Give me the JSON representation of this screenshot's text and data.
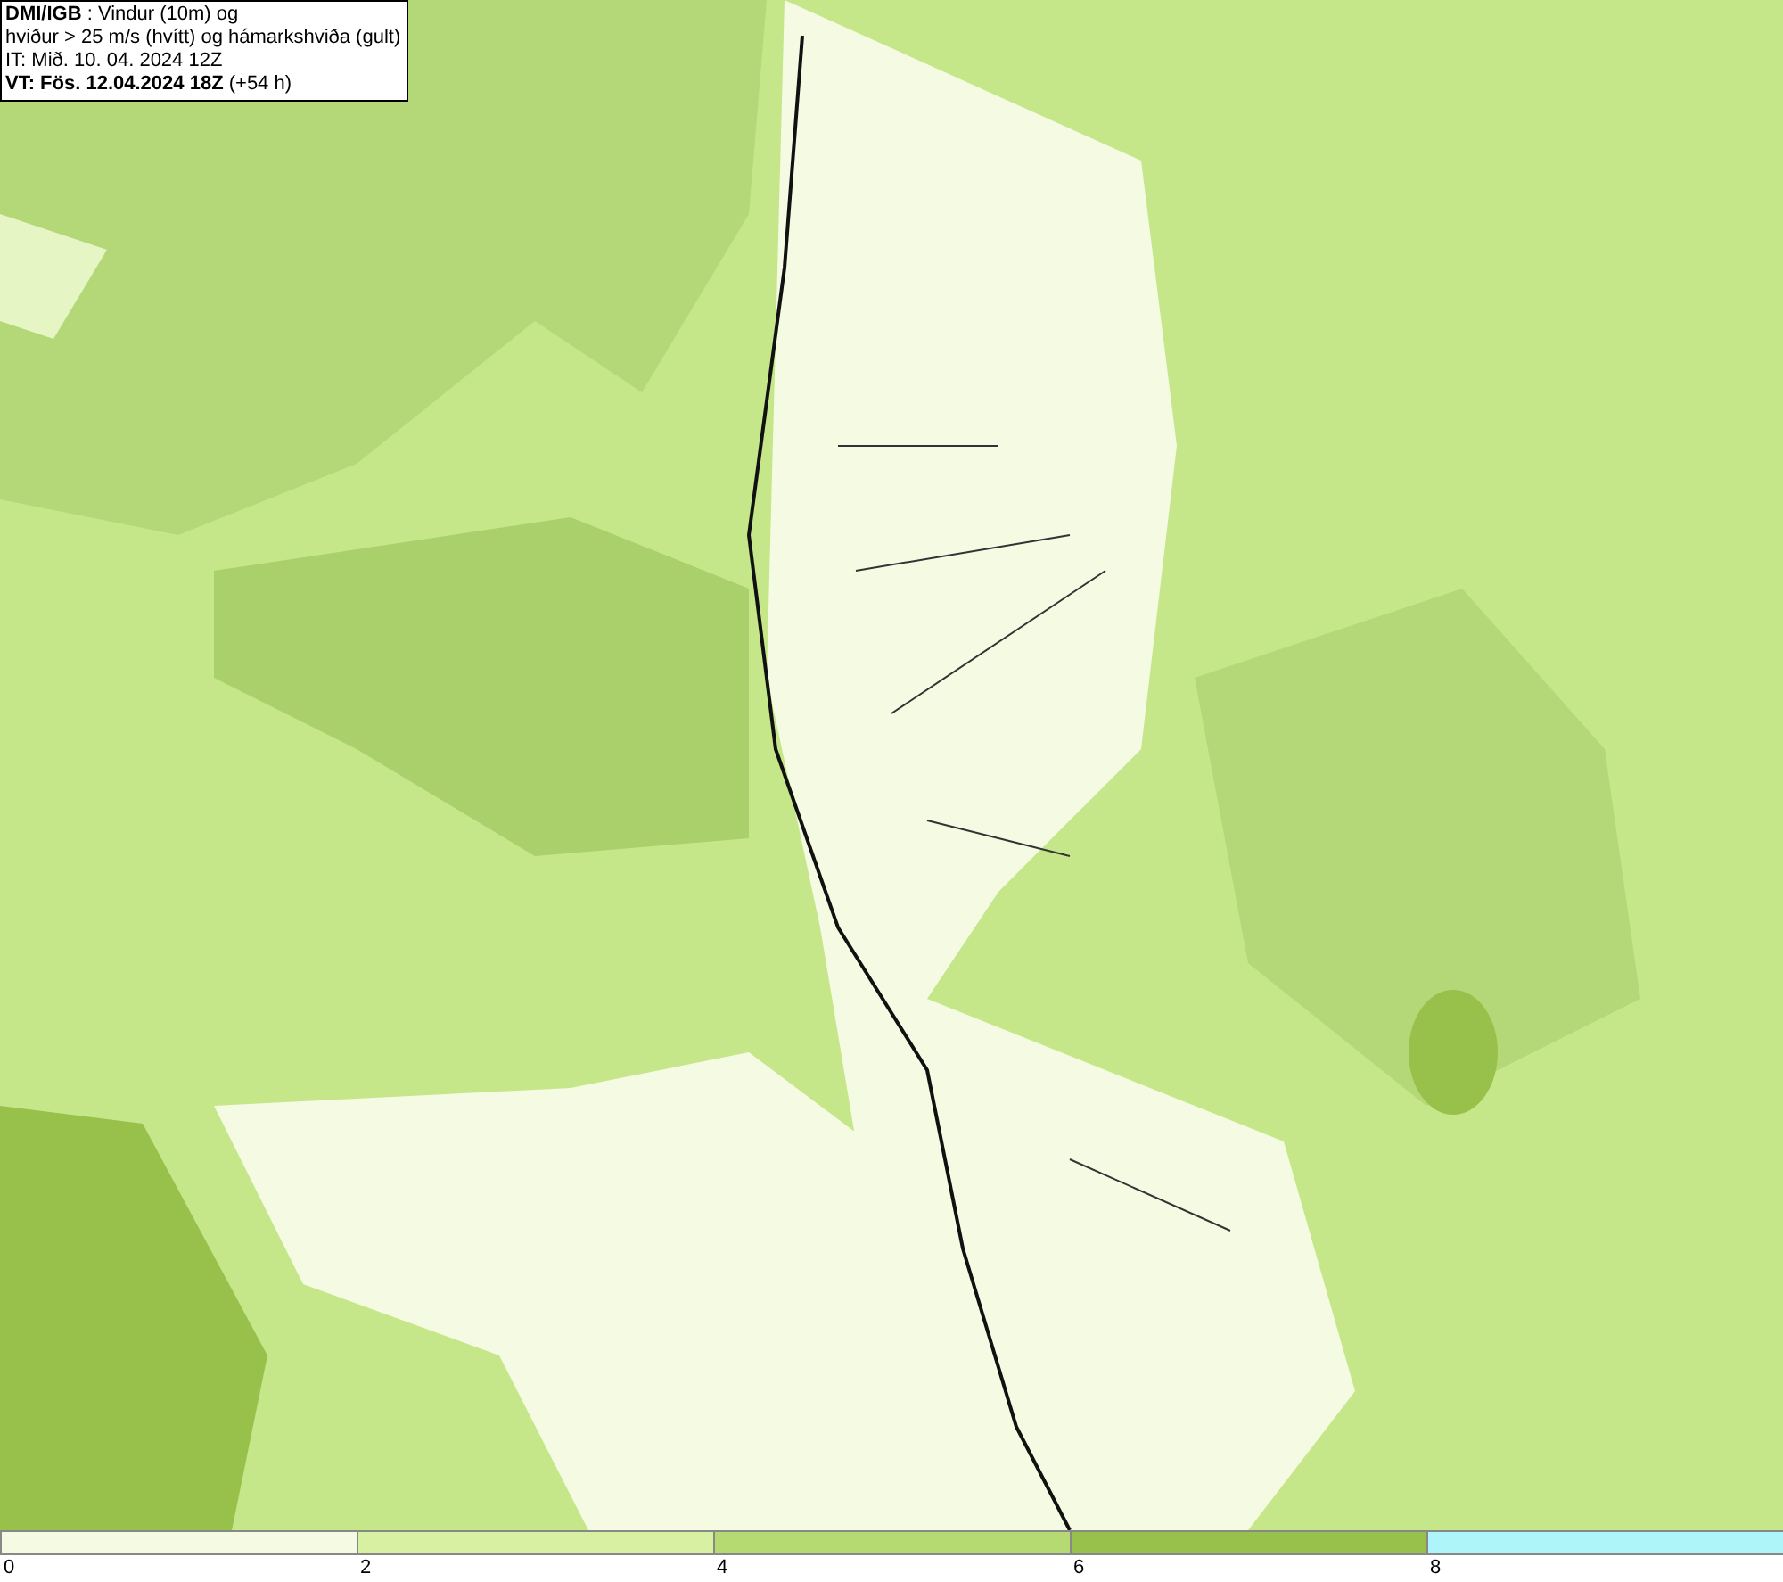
{
  "title_box": {
    "lines": [
      "**DMI/IGB** : Vindur (10m) og",
      "hviður > 25 m/s (hvítt) og hámarkshviða (gult)",
      "IT: Mið. 10. 04. 2024 12Z",
      "**VT: Fös. 12.04.2024 18Z** (+54 h)"
    ]
  },
  "legend": {
    "bins": [
      {
        "color": "#f4fbe2"
      },
      {
        "color": "#d8f0a2"
      },
      {
        "color": "#b6da72"
      },
      {
        "color": "#97c14a"
      },
      {
        "color": "#aef5f9"
      }
    ],
    "ticks": [
      "0",
      "2",
      "4",
      "6",
      "8"
    ]
  }
}
